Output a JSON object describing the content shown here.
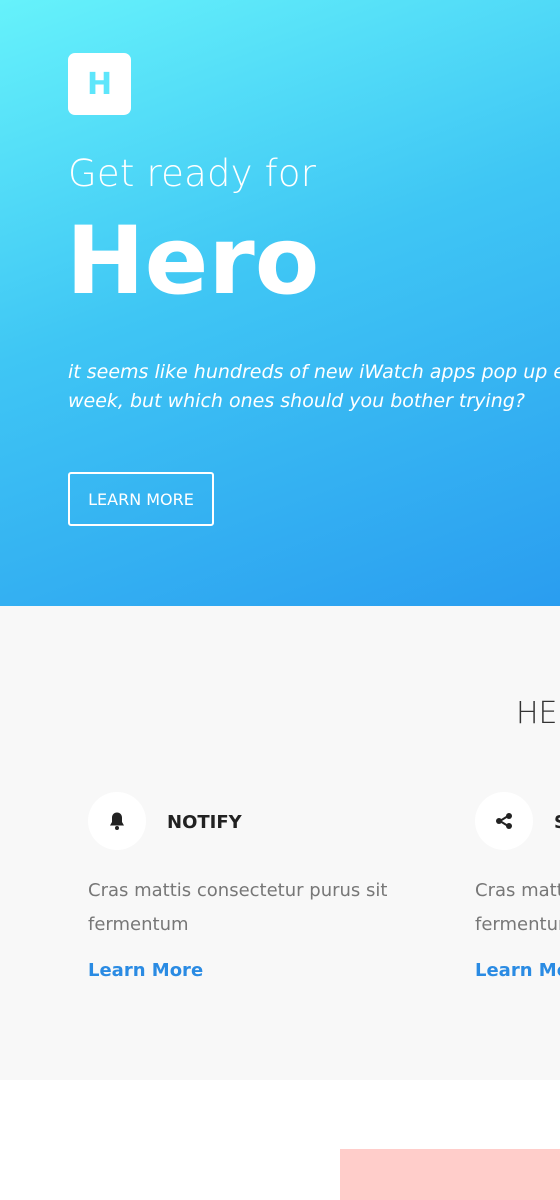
{
  "hero": {
    "logo_letter": "H",
    "subtitle": "Get ready for",
    "title": "Hero",
    "tagline_line1": "it seems like hundreds of new iWatch apps pop up every",
    "tagline_line2": "week, but which ones should you bother trying?",
    "button_label": "LEARN MORE",
    "gradient_colors": [
      "#66f2fb",
      "#2a9df0"
    ]
  },
  "features": {
    "heading": "HE",
    "items": [
      {
        "icon": "bell-icon",
        "title": "NOTIFY",
        "text": "Cras mattis consectetur purus sit fermentum",
        "link": "Learn More"
      },
      {
        "icon": "share-icon",
        "title": "S",
        "text": "Cras mattis consectetur purus sit fermentum",
        "link": "Learn More"
      }
    ],
    "link_color": "#2a8be3"
  },
  "accent_pink": "#ffcdca"
}
